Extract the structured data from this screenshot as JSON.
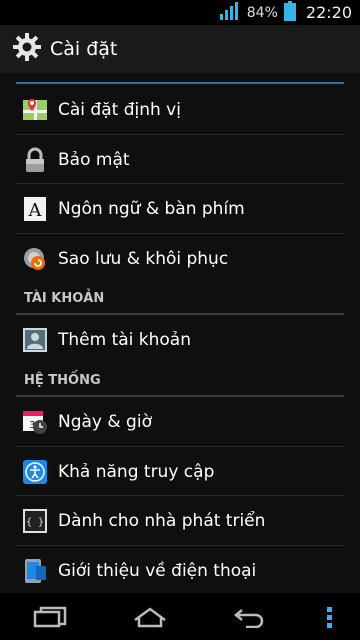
{
  "status": {
    "battery": "84%",
    "time": "22:20"
  },
  "actionbar": {
    "title": "Cài đặt"
  },
  "sections": {
    "accounts": "TÀI KHOẢN",
    "system": "HỆ THỐNG"
  },
  "items": [
    {
      "label": "Cài đặt định vị",
      "icon": "location-icon"
    },
    {
      "label": "Bảo mật",
      "icon": "lock-icon"
    },
    {
      "label": "Ngôn ngữ & bàn phím",
      "icon": "language-icon"
    },
    {
      "label": "Sao lưu & khôi phục",
      "icon": "backup-icon"
    },
    {
      "label": "Thêm tài khoản",
      "icon": "add-account-icon"
    },
    {
      "label": "Ngày & giờ",
      "icon": "date-time-icon"
    },
    {
      "label": "Khả năng truy cập",
      "icon": "accessibility-icon"
    },
    {
      "label": "Dành cho nhà phát triển",
      "icon": "developer-icon"
    },
    {
      "label": "Giới thiệu về điện thoại",
      "icon": "about-phone-icon"
    }
  ],
  "colors": {
    "accent": "#33b5e5",
    "divider": "#2a2a2a"
  }
}
